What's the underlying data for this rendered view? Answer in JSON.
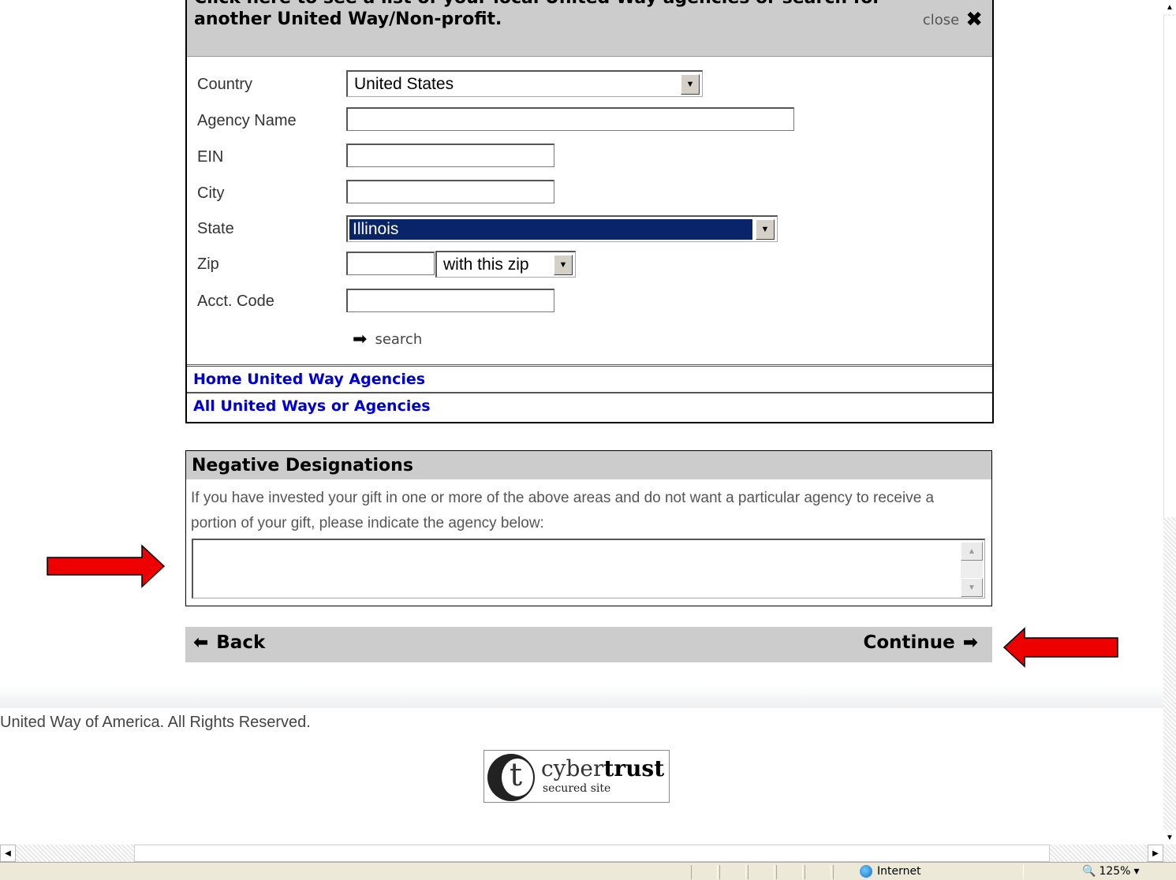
{
  "panel": {
    "header_cut_text": "Click here to see a list of your local United Way agencies or search for",
    "header_title": "another United Way/Non-profit.",
    "close_label": "close",
    "close_glyph": "✖",
    "fields": {
      "country_label": "Country",
      "country_value": "United States",
      "agency_label": "Agency Name",
      "ein_label": "EIN",
      "city_label": "City",
      "state_label": "State",
      "state_value": "Illinois",
      "zip_label": "Zip",
      "zip_mode_value": "with this zip",
      "acct_label": "Acct. Code"
    },
    "search_label": "search",
    "links": {
      "home": "Home United Way Agencies",
      "all": "All United Ways or Agencies"
    }
  },
  "negative": {
    "title": "Negative Designations",
    "text": "If you have invested your gift in one or more of the above areas and do not want a particular agency to receive a portion of your gift, please indicate the agency below:"
  },
  "nav": {
    "back_label": "Back",
    "continue_label": "Continue"
  },
  "footer": {
    "copyright": "United Way of America. All Rights Reserved.",
    "seal_brand_light": "cyber",
    "seal_brand_bold": "trust",
    "seal_sub": "secured site",
    "seal_letter": "t"
  },
  "statusbar": {
    "zone": "Internet",
    "zoom": "125%"
  },
  "colors": {
    "panel_header_bg": "#cccccc",
    "link_blue": "#0000cc",
    "selection_blue": "#0a246a",
    "annotation_red": "#ee0000"
  },
  "icons": {
    "arrow_right": "➡",
    "arrow_left": "⬅",
    "dropdown": "▼"
  }
}
